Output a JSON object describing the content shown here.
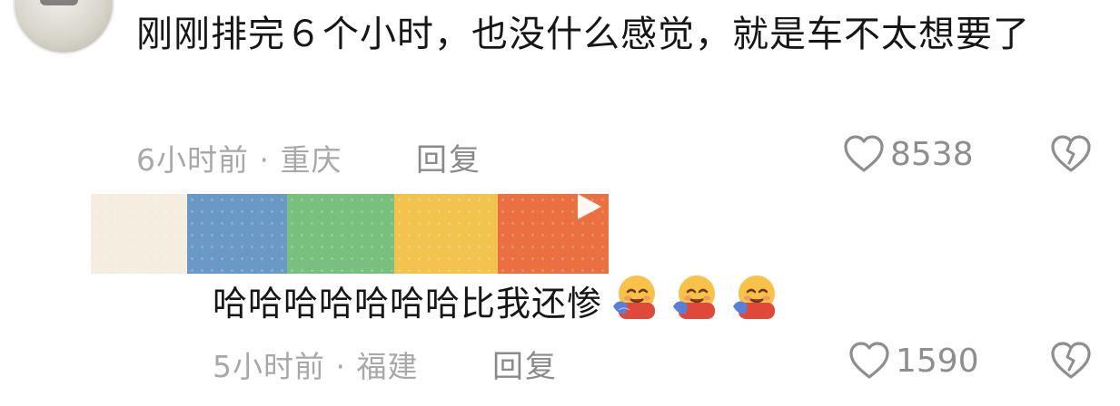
{
  "comment1": {
    "text": "刚刚排完６个小时，也没什么感觉，就是车不太想要了",
    "time_location": "6小时前 · 重庆",
    "reply_label": "回复",
    "likes": "8538"
  },
  "comment2": {
    "text": "哈哈哈哈哈哈哈比我还惨",
    "emojis": [
      "hugging-face-emoji",
      "hugging-face-emoji",
      "hugging-face-emoji"
    ],
    "time_location": "5小时前 · 福建",
    "reply_label": "回复",
    "likes": "1590"
  },
  "colors": {
    "sticker_segments": [
      "#f4ede0",
      "#6b99c6",
      "#79c07e",
      "#f2c34e",
      "#ea7042"
    ],
    "meta_gray": "#a8a8a8"
  }
}
